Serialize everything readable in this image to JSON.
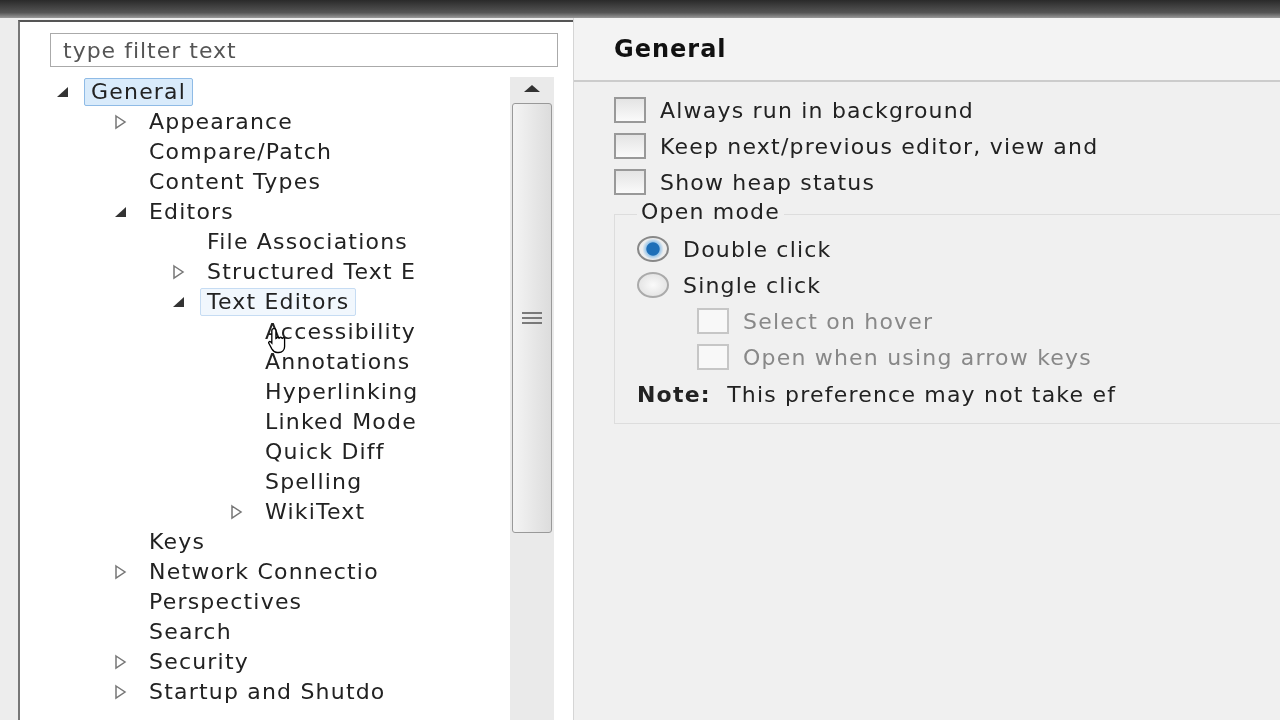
{
  "filter": {
    "placeholder": "type filter text"
  },
  "tree": [
    {
      "label": "General",
      "selected": true,
      "hovered": false,
      "expanded": true,
      "children": [
        {
          "label": "Appearance",
          "selected": false,
          "hovered": false,
          "expanded": false
        },
        {
          "label": "Compare/Patch",
          "selected": false,
          "hovered": false
        },
        {
          "label": "Content Types",
          "selected": false,
          "hovered": false
        },
        {
          "label": "Editors",
          "selected": false,
          "hovered": false,
          "expanded": true,
          "children": [
            {
              "label": "File Associations",
              "selected": false,
              "hovered": false
            },
            {
              "label": "Structured Text E",
              "selected": false,
              "hovered": false,
              "expanded": false
            },
            {
              "label": "Text Editors",
              "selected": false,
              "hovered": true,
              "expanded": true,
              "children": [
                {
                  "label": "Accessibility",
                  "selected": false,
                  "hovered": false
                },
                {
                  "label": "Annotations",
                  "selected": false,
                  "hovered": false
                },
                {
                  "label": "Hyperlinking",
                  "selected": false,
                  "hovered": false
                },
                {
                  "label": "Linked Mode",
                  "selected": false,
                  "hovered": false
                },
                {
                  "label": "Quick Diff",
                  "selected": false,
                  "hovered": false
                },
                {
                  "label": "Spelling",
                  "selected": false,
                  "hovered": false
                },
                {
                  "label": "WikiText",
                  "selected": false,
                  "hovered": false,
                  "expanded": false
                }
              ]
            }
          ]
        },
        {
          "label": "Keys",
          "selected": false,
          "hovered": false
        },
        {
          "label": "Network Connectio",
          "selected": false,
          "hovered": false,
          "expanded": false
        },
        {
          "label": "Perspectives",
          "selected": false,
          "hovered": false
        },
        {
          "label": "Search",
          "selected": false,
          "hovered": false
        },
        {
          "label": "Security",
          "selected": false,
          "hovered": false,
          "expanded": false
        },
        {
          "label": "Startup and Shutdo",
          "selected": false,
          "hovered": false,
          "expanded": false
        }
      ]
    }
  ],
  "page": {
    "title": "General",
    "options": [
      {
        "label": "Always run in background",
        "checked": false
      },
      {
        "label": "Keep next/previous editor, view and",
        "checked": false
      },
      {
        "label": "Show heap status",
        "checked": false
      }
    ],
    "open_mode": {
      "title": "Open mode",
      "choices": [
        {
          "label": "Double click",
          "selected": true
        },
        {
          "label": "Single click",
          "selected": false
        }
      ],
      "sub_options": [
        {
          "label": "Select on hover",
          "checked": false,
          "disabled": true
        },
        {
          "label": "Open when using arrow keys",
          "checked": false,
          "disabled": true
        }
      ]
    },
    "note": "**Note:**  This preference may not take ef"
  }
}
